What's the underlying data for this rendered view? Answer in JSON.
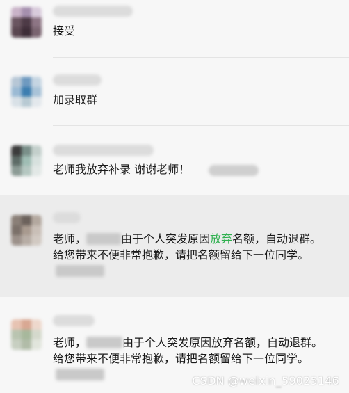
{
  "messages": [
    {
      "text": "接受",
      "avatar_colors": [
        "#c9b3c8",
        "#a58fae",
        "#d8cadb",
        "#6a5560",
        "#4d3a46",
        "#8d7584",
        "#5a4650",
        "#3e2d38",
        "#7a6470"
      ]
    },
    {
      "text": "加录取群",
      "avatar_colors": [
        "#b7c7d6",
        "#6f9ac0",
        "#c5d5e2",
        "#9bbad4",
        "#3d7eb0",
        "#a9c3d8",
        "#d9e1e7",
        "#b8cad3",
        "#e3e8ec"
      ]
    },
    {
      "text": "老师我放弃补录 谢谢老师！",
      "avatar_colors": [
        "#3c3c3c",
        "#7a8f89",
        "#c3cfcb",
        "#5d6b66",
        "#9fbdb4",
        "#d7e1de",
        "#8c9b95",
        "#b5c7c1",
        "#e2e8e6"
      ]
    },
    {
      "part1": "老师，",
      "part2": "由于个人突发原因",
      "highlight": "放弃",
      "part3": "名额，自动退群。给您带来不便非常抱歉，请把名额留给下一位同学。",
      "avatar_colors": [
        "#8a7f77",
        "#6c625c",
        "#b3a89f",
        "#7b7069",
        "#a89a8f",
        "#c9bfb7",
        "#9c918a",
        "#b7ada5",
        "#d1c9c2"
      ]
    },
    {
      "part1": "老师，",
      "part2": "由于个人突发原因放弃名额，自动退群。给您带来不便非常抱歉，请把名额留给下一位同学。",
      "avatar_colors": [
        "#e7c3b2",
        "#d9a893",
        "#eed8cc",
        "#b9c4b0",
        "#a7b89c",
        "#d4d9cc",
        "#c7cfc1",
        "#b1bca8",
        "#e1e5dc"
      ]
    }
  ],
  "watermark": "CSDN @weixin_59025146",
  "colors": {
    "highlight_green": "#2fb04f",
    "selected_row_bg": "#ececec",
    "list_bg": "#f7f7f7"
  }
}
